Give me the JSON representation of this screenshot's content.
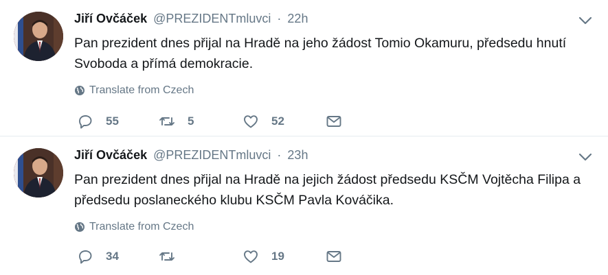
{
  "tweets": [
    {
      "name": "Jiří Ovčáček",
      "handle": "@PREZIDENTmluvci",
      "dot": "·",
      "time": "22h",
      "text": "Pan prezident dnes přijal na Hradě na jeho žádost Tomio Okamuru, předsedu hnutí Svoboda a přímá demokracie.",
      "translate_label": "Translate from Czech",
      "reply_count": "55",
      "retweet_count": "5",
      "like_count": "52"
    },
    {
      "name": "Jiří Ovčáček",
      "handle": "@PREZIDENTmluvci",
      "dot": "·",
      "time": "23h",
      "text": "Pan prezident dnes přijal na Hradě na jejich žádost předsedu KSČM Vojtěcha Filipa a předsedu poslaneckého klubu KSČM Pavla Kováčika.",
      "translate_label": "Translate from Czech",
      "reply_count": "34",
      "retweet_count": "",
      "like_count": "19"
    }
  ],
  "icons": {
    "reply": "reply-icon",
    "retweet": "retweet-icon",
    "like": "heart-icon",
    "dm": "envelope-icon",
    "more": "chevron-down-icon",
    "translate": "globe-icon"
  },
  "colors": {
    "text": "#14171a",
    "secondary": "#657786",
    "divider": "#e6ecf0"
  }
}
